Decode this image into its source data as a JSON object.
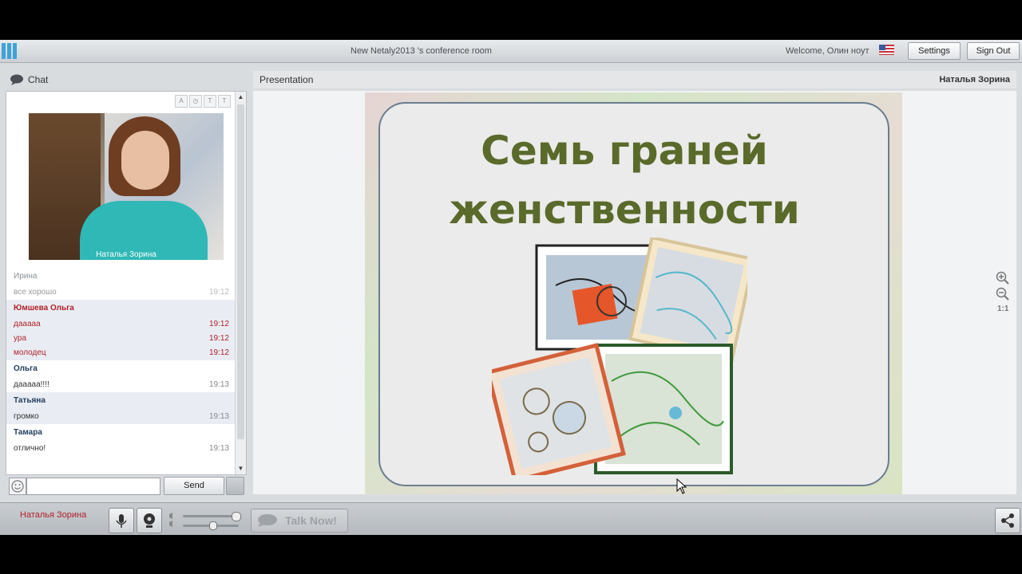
{
  "topbar": {
    "room_title": "New Netaly2013 's conference room",
    "welcome": "Welcome, Олин ноут",
    "settings_label": "Settings",
    "signout_label": "Sign Out"
  },
  "chat": {
    "header": "Chat",
    "video_name": "Наталья Зорина",
    "messages": [
      {
        "author": "Ирина",
        "author_color": "#8a9099",
        "lines": [
          {
            "text": "все хорошо",
            "time": "19:12",
            "color": "#999999"
          }
        ]
      },
      {
        "author": "Юмшева Ольга",
        "author_color": "#b0202a",
        "lines": [
          {
            "text": "дааааа",
            "time": "19:12",
            "color": "#b0202a"
          },
          {
            "text": "ура",
            "time": "19:12",
            "color": "#b0202a"
          },
          {
            "text": "молодец",
            "time": "19:12",
            "color": "#b0202a"
          }
        ]
      },
      {
        "author": "Ольга",
        "author_color": "#1f3b5a",
        "lines": [
          {
            "text": "дааааа!!!!",
            "time": "19:13",
            "color": "#333333"
          }
        ]
      },
      {
        "author": "Татьяна",
        "author_color": "#1f3b5a",
        "lines": [
          {
            "text": "громко",
            "time": "19:13",
            "color": "#333333"
          }
        ]
      },
      {
        "author": "Тамара",
        "author_color": "#1f3b5a",
        "lines": [
          {
            "text": "отлично!",
            "time": "19:13",
            "color": "#333333"
          }
        ]
      }
    ],
    "send_label": "Send"
  },
  "presentation": {
    "header": "Presentation",
    "presenter": "Наталья Зорина",
    "slide_title_1": "Семь граней",
    "slide_title_2": "женственности",
    "zoom_label": "1:1"
  },
  "bottom": {
    "user_name": "Наталья Зорина",
    "talk_label": "Talk Now!"
  },
  "icons": [
    "logo-icon",
    "flag-icon",
    "chat-bubble-icon",
    "smiley-icon",
    "microphone-icon",
    "webcam-icon",
    "speaker-icon",
    "share-icon",
    "zoom-in-icon",
    "zoom-out-icon"
  ],
  "colors": {
    "accent_red": "#b0202a",
    "topbar": "#dfe2e5",
    "slide_title": "#5a6a2a"
  }
}
